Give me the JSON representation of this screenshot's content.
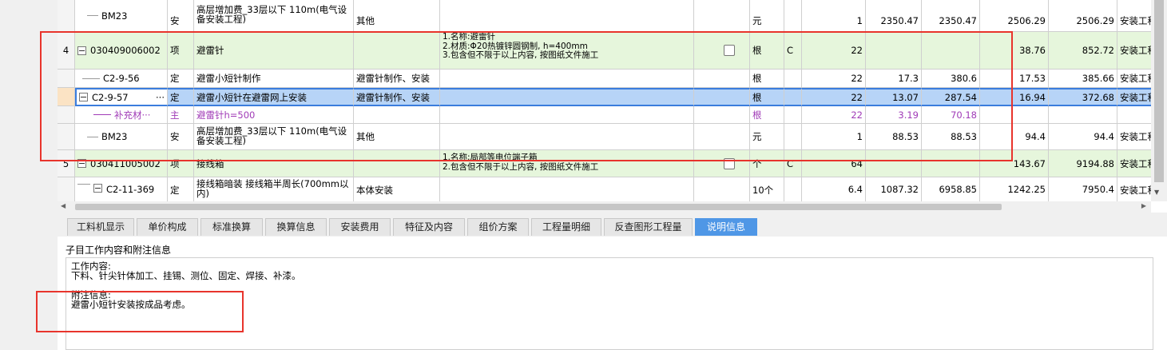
{
  "grid": {
    "rows": [
      {
        "idx": "",
        "code": "BM23",
        "type": "安",
        "name": "高层增加费_33层以下 110m(电气设备安装工程)",
        "category": "其他",
        "features": "",
        "unit": "元",
        "flag": "",
        "qty": "1",
        "p1": "2350.47",
        "p2": "2350.47",
        "p3": "2506.29",
        "p4": "2506.29",
        "profession": "安装工程"
      },
      {
        "idx": "4",
        "code": "030409006002",
        "type": "项",
        "name": "避雷针",
        "category": "",
        "features": [
          "1.名称:避雷针",
          "2.材质:Φ20热镀锌圆钢制, h=400mm",
          "3.包含但不限于以上内容, 按图纸文件施工"
        ],
        "unit": "根",
        "flag": "C",
        "qty": "22",
        "p1": "",
        "p2": "",
        "p3": "38.76",
        "p4": "852.72",
        "profession": "安装工程"
      },
      {
        "idx": "",
        "code": "C2-9-56",
        "type": "定",
        "name": "避雷小短针制作",
        "category": "避雷针制作、安装",
        "features": "",
        "unit": "根",
        "flag": "",
        "qty": "22",
        "p1": "17.3",
        "p2": "380.6",
        "p3": "17.53",
        "p4": "385.66",
        "profession": "安装工程"
      },
      {
        "idx": "",
        "code": "C2-9-57",
        "ellipsis": "···",
        "type": "定",
        "name": "避雷小短针在避雷网上安装",
        "category": "避雷针制作、安装",
        "features": "",
        "unit": "根",
        "flag": "",
        "qty": "22",
        "p1": "13.07",
        "p2": "287.54",
        "p3": "16.94",
        "p4": "372.68",
        "profession": "安装工程"
      },
      {
        "idx": "",
        "code": "补充材···",
        "type": "主",
        "name": "避雷针h=500",
        "category": "",
        "features": "",
        "unit": "根",
        "flag": "",
        "qty": "22",
        "p1": "3.19",
        "p2": "70.18",
        "p3": "",
        "p4": "",
        "profession": ""
      },
      {
        "idx": "",
        "code": "BM23",
        "type": "安",
        "name": "高层增加费_33层以下 110m(电气设备安装工程)",
        "category": "其他",
        "features": "",
        "unit": "元",
        "flag": "",
        "qty": "1",
        "p1": "88.53",
        "p2": "88.53",
        "p3": "94.4",
        "p4": "94.4",
        "profession": "安装工程"
      },
      {
        "idx": "5",
        "code": "030411005002",
        "type": "项",
        "name": "接线箱",
        "category": "",
        "features": [
          "1.名称:局部等电位端子箱",
          "2.包含但不限于以上内容, 按图纸文件施工"
        ],
        "unit": "个",
        "flag": "C",
        "qty": "64",
        "p1": "",
        "p2": "",
        "p3": "143.67",
        "p4": "9194.88",
        "profession": "安装工程"
      },
      {
        "idx": "",
        "code": "C2-11-369",
        "type": "定",
        "name": "接线箱暗装 接线箱半周长(700mm以内)",
        "category": "本体安装",
        "features": "",
        "unit": "10个",
        "flag": "",
        "qty": "6.4",
        "p1": "1087.32",
        "p2": "6958.85",
        "p3": "1242.25",
        "p4": "7950.4",
        "profession": "安装工程"
      }
    ]
  },
  "tabs": [
    "工料机显示",
    "单价构成",
    "标准换算",
    "换算信息",
    "安装费用",
    "特征及内容",
    "组价方案",
    "工程量明细",
    "反查图形工程量",
    "说明信息"
  ],
  "active_tab": "说明信息",
  "panel": {
    "title": "子目工作内容和附注信息",
    "work_label": "工作内容:",
    "work_text": "下料、针尖针体加工、挂锡、测位、固定、焊接、补漆。",
    "note_label": "附注信息:",
    "note_text": "避雷小短针安装按成品考虑。"
  },
  "colors": {
    "selected_row": "#b7d4f7",
    "item_row": "#e6f6dc",
    "annotation_red": "#e8342c",
    "active_tab": "#4f97e6",
    "material_text": "#a03bb7"
  }
}
